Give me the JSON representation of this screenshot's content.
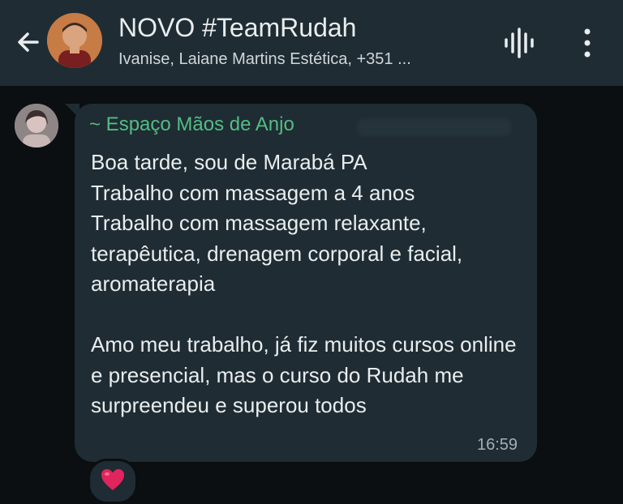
{
  "header": {
    "title": "NOVO #TeamRudah",
    "subtitle": "Ivanise, Laiane Martins Estética, +351 ...",
    "back_icon": "arrow-left-icon",
    "voice_icon": "audio-wave-icon",
    "more_icon": "more-vertical-icon"
  },
  "message": {
    "sender": "~ Espaço Mãos de Anjo",
    "text": "Boa tarde, sou de Marabá PA\nTrabalho com massagem a 4 anos\nTrabalho com massagem relaxante, terapêutica, drenagem corporal e facial, aromaterapia\n\nAmo meu trabalho, já fiz muitos cursos online e presencial, mas o curso do Rudah me surpreendeu e superou todos",
    "time": "16:59",
    "reaction": "❤️"
  },
  "colors": {
    "header_bg": "#1f2c33",
    "chat_bg": "#0b0f12",
    "bubble_bg": "#1f2c33",
    "sender_name": "#53bd84",
    "text": "#e9edef",
    "heart": "#e0245e"
  }
}
